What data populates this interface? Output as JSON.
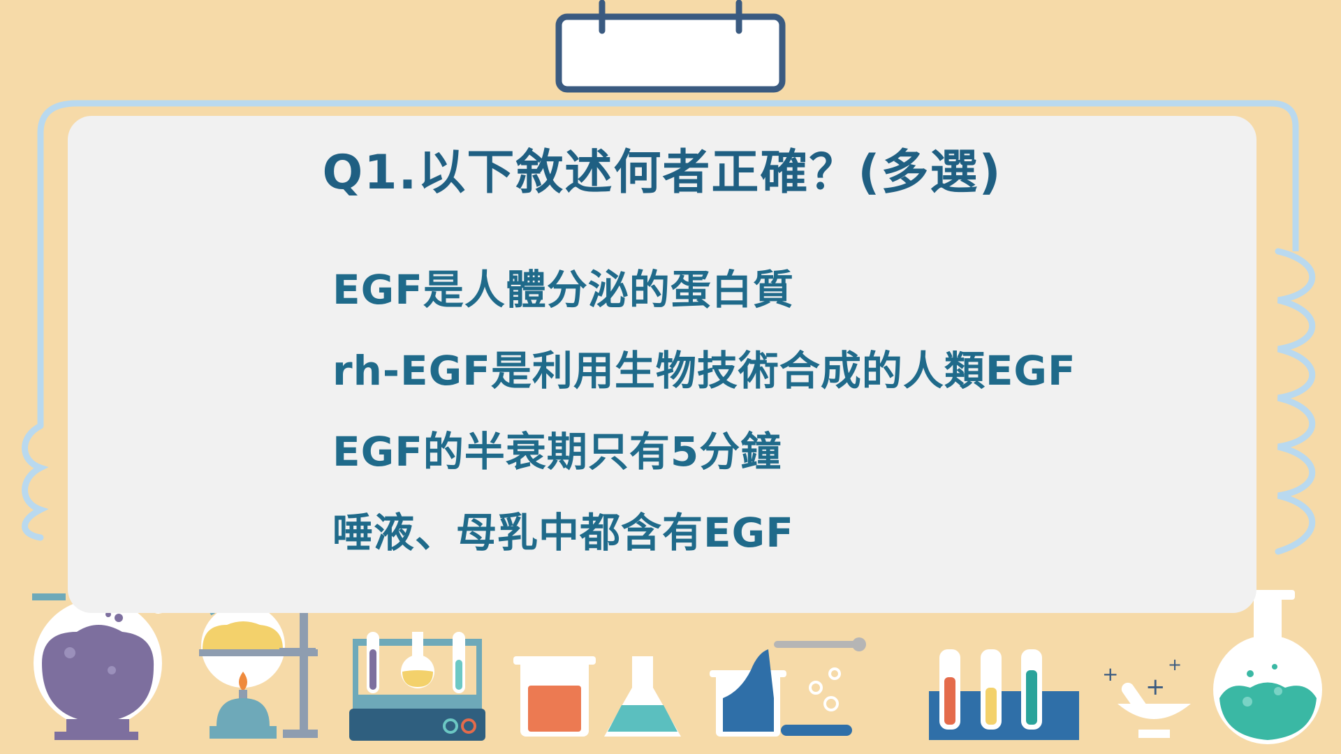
{
  "slide": {
    "question": "Q1.以下敘述何者正確？(多選)",
    "options": [
      "EGF是人體分泌的蛋白質",
      "rh-EGF是利用生物技術合成的人類EGF",
      "EGF的半衰期只有5分鐘",
      "唾液、母乳中都含有EGF"
    ]
  },
  "colors": {
    "background": "#f6daa8",
    "board": "#f1f1f1",
    "title_text": "#1f5f82",
    "option_text": "#1f6a8a",
    "frame_line": "#b9d9ef",
    "accent_navy": "#3a5a80"
  }
}
